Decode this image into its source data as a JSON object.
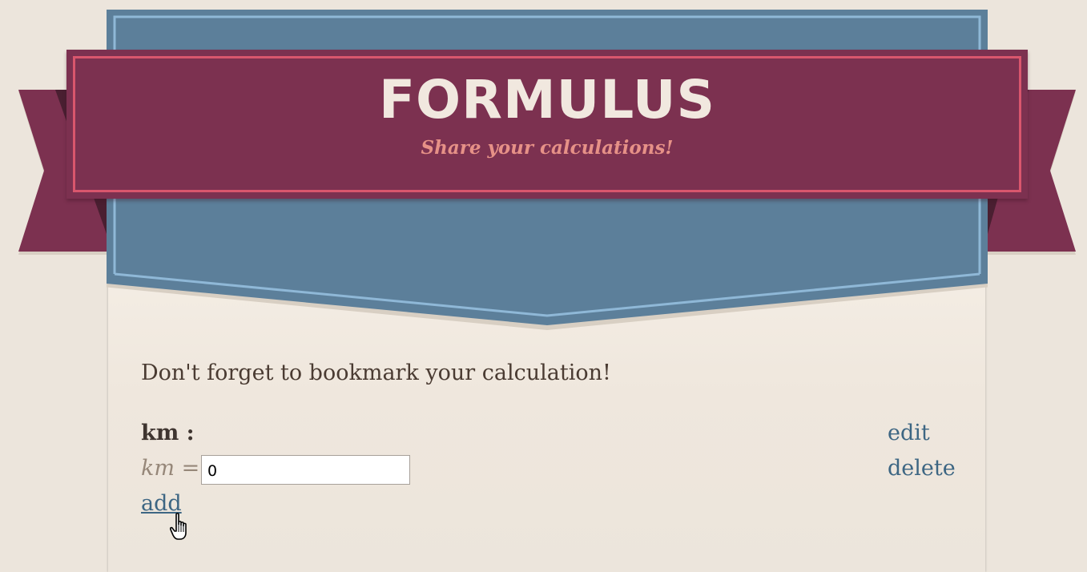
{
  "header": {
    "title": "FORMULUS",
    "tagline": "Share your calculations!"
  },
  "colors": {
    "shield_blue": "#5c7f9a",
    "ribbon_maroon": "#7c3150",
    "ribbon_border": "#d9566d",
    "tagline_pink": "#e69187",
    "link_blue": "#3d6683",
    "background": "#ece5dc"
  },
  "main": {
    "notice": "Don't forget to bookmark your calculation!",
    "variable": {
      "heading": "km :",
      "expression_name": "km",
      "equals": "=",
      "input_value": "0",
      "edit_label": "edit",
      "delete_label": "delete"
    },
    "add_label": "add"
  },
  "icons": {
    "cursor": "hand-pointer-icon"
  }
}
